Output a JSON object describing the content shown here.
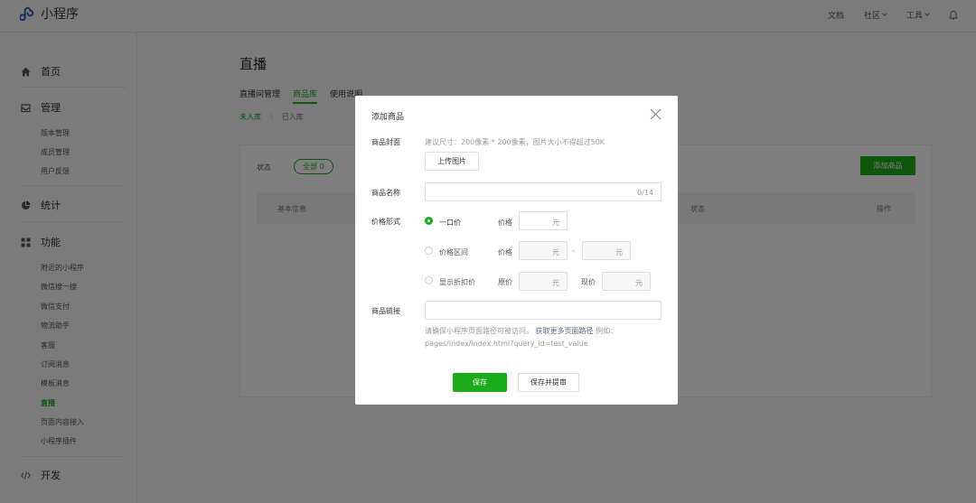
{
  "app": {
    "name": "小程序"
  },
  "topnav": {
    "docs": "文档",
    "community": "社区",
    "tools": "工具"
  },
  "sidebar": {
    "home": "首页",
    "manage": "管理",
    "manage_items": [
      "版本管理",
      "成员管理",
      "用户反馈"
    ],
    "stats": "统计",
    "features": "功能",
    "feature_items": [
      "附近的小程序",
      "微信搜一搜",
      "微信支付",
      "物流助手",
      "客服",
      "订阅消息",
      "模板消息",
      "直播",
      "页面内容接入",
      "小程序插件"
    ],
    "dev": "开发"
  },
  "main": {
    "title": "直播",
    "tabs": [
      "直播间管理",
      "商品库",
      "使用说明"
    ],
    "subtabs": [
      "未入库",
      "已入库"
    ],
    "filter_label": "状态",
    "filter_pill": "全部 0",
    "add_button": "添加商品",
    "table_headers": {
      "basic": "基本信息",
      "status": "状态",
      "ops": "操作"
    }
  },
  "modal": {
    "title": "添加商品",
    "cover_label": "商品封面",
    "cover_hint": "建议尺寸：200像素 * 200像素，图片大小不得超过50K",
    "upload_button": "上传图片",
    "name_label": "商品名称",
    "name_counter": "0/14",
    "price_label": "价格形式",
    "price_options": [
      {
        "label": "一口价",
        "selected": true
      },
      {
        "label": "价格区间",
        "selected": false
      },
      {
        "label": "显示折扣价",
        "selected": false
      }
    ],
    "price_field": "价格",
    "original_price": "原价",
    "current_price": "现价",
    "unit": "元",
    "range_sep": "-",
    "link_label": "商品链接",
    "link_note_prefix": "请确保小程序页面路径可被访问。",
    "link_note_link": "获取更多页面路径",
    "link_note_suffix": "例如：pages/index/index.html?query_id=test_value",
    "save_button": "保存",
    "save_submit_button": "保存并提审"
  },
  "colors": {
    "accent": "#1aad19",
    "link": "#576b95"
  }
}
